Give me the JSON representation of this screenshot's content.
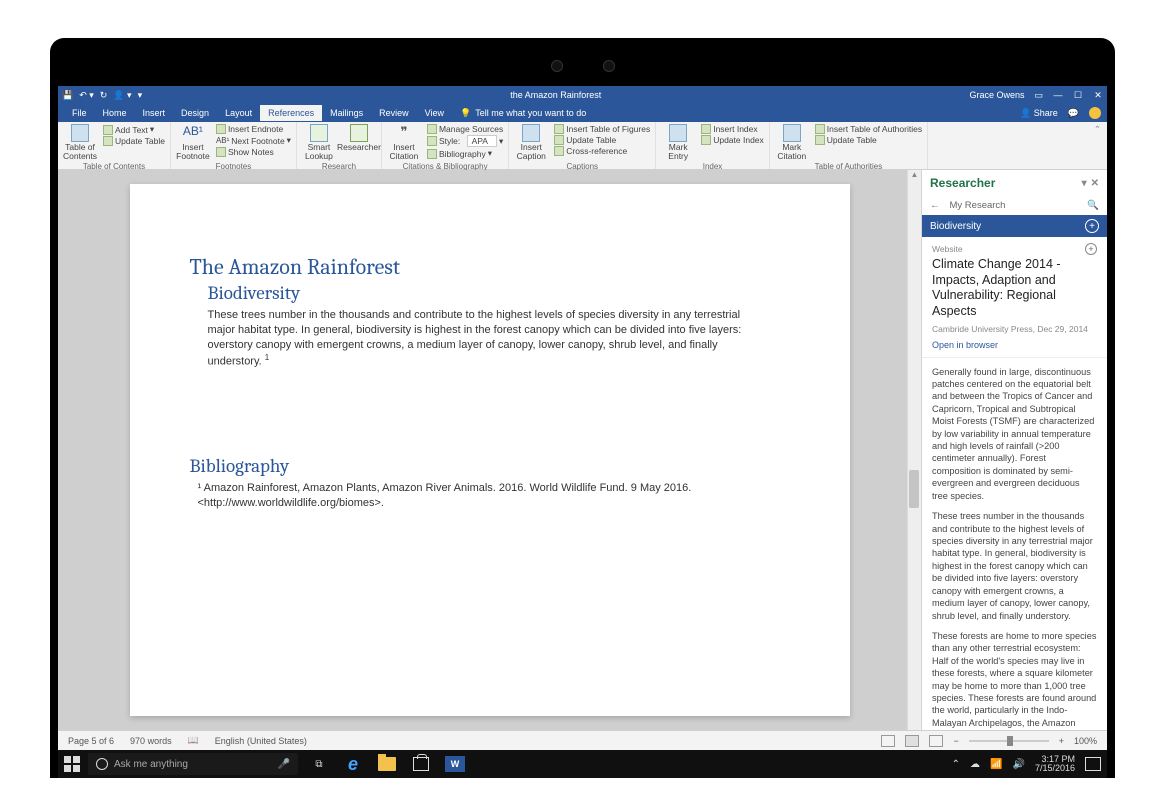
{
  "titlebar": {
    "doc_title": "the Amazon Rainforest",
    "user": "Grace Owens"
  },
  "tabs": {
    "file": "File",
    "home": "Home",
    "insert": "Insert",
    "design": "Design",
    "layout": "Layout",
    "references": "References",
    "mailings": "Mailings",
    "review": "Review",
    "view": "View",
    "tell": "Tell me what you want to do",
    "share": "Share"
  },
  "ribbon": {
    "toc": {
      "big": "Table of\nContents",
      "addtext": "Add Text",
      "update": "Update Table",
      "label": "Table of Contents"
    },
    "fn": {
      "big": "Insert\nFootnote",
      "sym": "AB¹",
      "insert_endnote": "Insert Endnote",
      "next_footnote": "Next Footnote",
      "show_notes": "Show Notes",
      "label": "Footnotes"
    },
    "res": {
      "smart": "Smart\nLookup",
      "researcher": "Researcher",
      "label": "Research"
    },
    "cit": {
      "big": "Insert\nCitation",
      "manage": "Manage Sources",
      "style_lbl": "Style:",
      "style_val": "APA",
      "biblio": "Bibliography",
      "label": "Citations & Bibliography"
    },
    "cap": {
      "big": "Insert\nCaption",
      "tof": "Insert Table of Figures",
      "updt": "Update Table",
      "cross": "Cross-reference",
      "label": "Captions"
    },
    "idx": {
      "big": "Mark\nEntry",
      "ins": "Insert Index",
      "upd": "Update Index",
      "label": "Index"
    },
    "toa": {
      "big": "Mark\nCitation",
      "ins": "Insert Table of Authorities",
      "upd": "Update Table",
      "label": "Table of Authorities"
    }
  },
  "document": {
    "h1": "The Amazon Rainforest",
    "h2": "Biodiversity",
    "para": "These trees number in the thousands and contribute to the highest levels of species diversity in any terrestrial major habitat type. In general, biodiversity is highest in the forest canopy which can be divided into five layers: overstory canopy with emergent crowns, a medium layer of canopy, lower canopy, shrub level, and finally understory. ",
    "sup": "1",
    "bib_h": "Bibliography",
    "bib_entry": "¹ Amazon Rainforest, Amazon Plants, Amazon River Animals. 2016. World Wildlife Fund. 9 May 2016. <http://www.worldwildlife.org/biomes>."
  },
  "researcher": {
    "title": "Researcher",
    "back": "←",
    "nav": "My Research",
    "topic": "Biodiversity",
    "card": {
      "kind": "Website",
      "title": "Climate Change 2014 - Impacts, Adaption and Vulnerability: Regional Aspects",
      "meta": "Cambride University Press, Dec 29, 2014",
      "open": "Open in browser"
    },
    "p1": "Generally found in large, discontinuous patches centered on the equatorial belt and between the Tropics of Cancer and Capricorn, Tropical and Subtropical Moist Forests (TSMF) are characterized by low variability in annual temperature and high levels of rainfall (>200 centimeter annually). Forest composition is dominated by semi-evergreen and evergreen deciduous tree species.",
    "p2": "These trees number in the thousands and contribute to the highest levels of species diversity in any terrestrial major habitat type. In general, biodiversity is highest in the forest canopy which can be divided into five layers: overstory canopy with emergent crowns, a medium layer of canopy, lower canopy, shrub level, and finally understory.",
    "p3": "These forests are home to more species than any other terrestrial ecosystem: Half of the world's species may live in these forests, where a square kilometer may be home to more than 1,000 tree species. These forests are found around the world, particularly in the Indo-Malayan Archipelagos, the Amazon Basin, and the African Congo. A perpetually warm, wet climate promotes more explosive plant growth than in any other environment on Earth."
  },
  "status": {
    "page": "Page 5 of 6",
    "words": "970 words",
    "lang": "English (United States)",
    "zoom": "100%"
  },
  "taskbar": {
    "cortana": "Ask me anything",
    "time": "3:17 PM",
    "date": "7/15/2016"
  }
}
